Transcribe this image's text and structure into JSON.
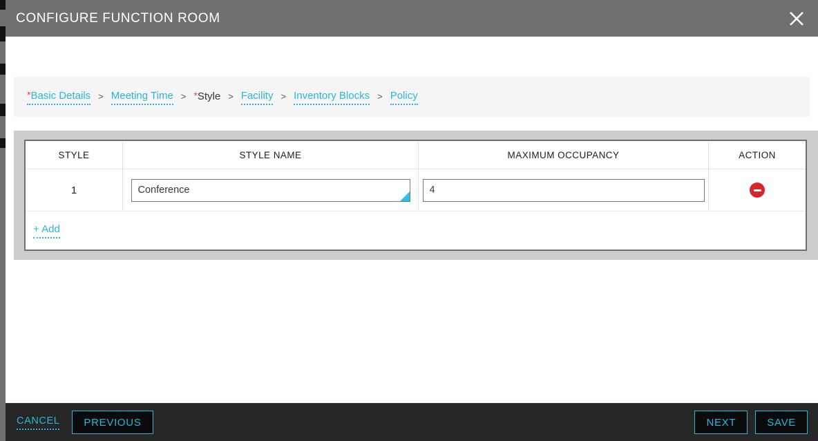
{
  "colors": {
    "accent": "#29b6dd",
    "titlebar": "#707070",
    "footer": "#262626",
    "panel_gray": "#cccccc",
    "breadcrumb_bg": "#f5f5f5",
    "required_star": "#e8453c",
    "remove_red": "#d8272c",
    "resize_corner": "#2ec0e8"
  },
  "titlebar": {
    "title": "CONFIGURE FUNCTION ROOM",
    "close_icon": "close-icon"
  },
  "breadcrumb": {
    "separator": ">",
    "required_marker": "*",
    "items": [
      {
        "label": "Basic Details",
        "required": true,
        "active": false
      },
      {
        "label": "Meeting Time",
        "required": false,
        "active": false
      },
      {
        "label": "Style",
        "required": true,
        "active": true
      },
      {
        "label": "Facility",
        "required": false,
        "active": false
      },
      {
        "label": "Inventory Blocks",
        "required": false,
        "active": false
      },
      {
        "label": "Policy",
        "required": false,
        "active": false
      }
    ]
  },
  "grid": {
    "columns": [
      {
        "key": "style",
        "label": "STYLE"
      },
      {
        "key": "name",
        "label": "STYLE NAME"
      },
      {
        "key": "occ",
        "label": "MAXIMUM OCCUPANCY"
      },
      {
        "key": "action",
        "label": "ACTION"
      }
    ],
    "rows": [
      {
        "index": "1",
        "style_name": {
          "value": "Conference",
          "placeholder": ""
        },
        "maximum_occupancy": {
          "value": "4",
          "placeholder": ""
        },
        "action_icon": "remove-circle-icon"
      }
    ],
    "add_label": "+ Add"
  },
  "footer": {
    "cancel_label": "CANCEL",
    "previous_label": "PREVIOUS",
    "next_label": "NEXT",
    "save_label": "SAVE"
  }
}
